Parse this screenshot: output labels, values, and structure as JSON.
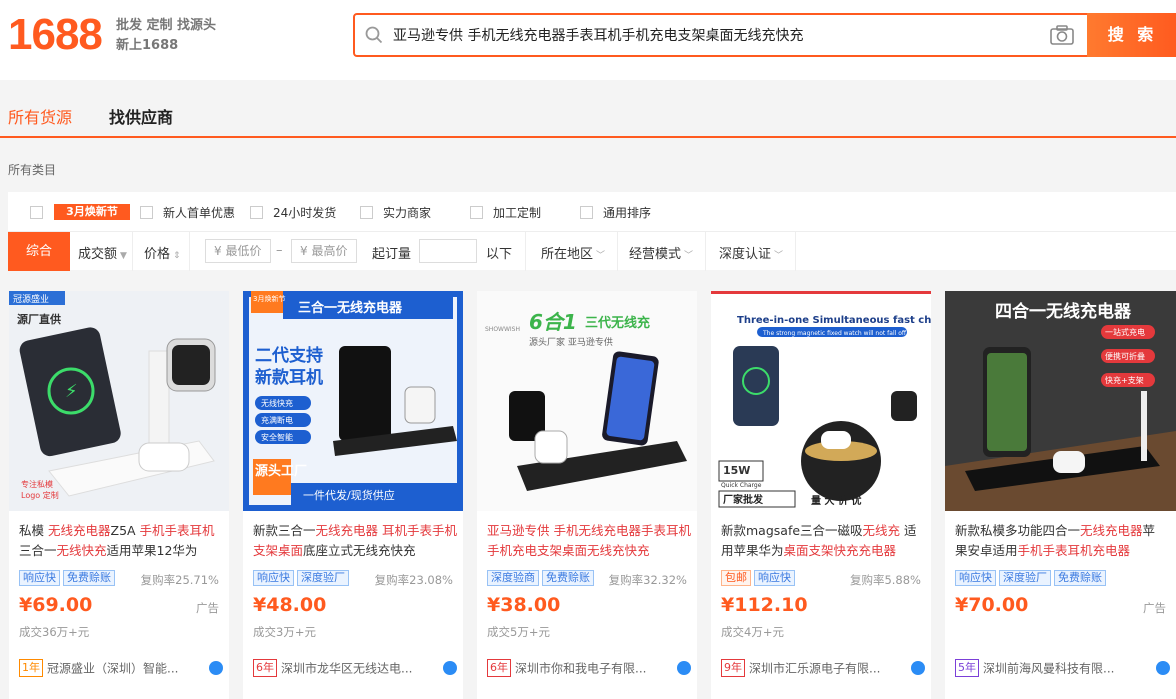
{
  "logo": {
    "text": "1688",
    "slogan_line1": "批发 定制 找源头",
    "slogan_line2": "新上1688"
  },
  "search": {
    "value": "亚马逊专供 手机无线充电器手表耳机手机充电支架桌面无线充快充",
    "button": "搜 索"
  },
  "tabs": [
    {
      "label": "所有货源",
      "active": true
    },
    {
      "label": "找供应商",
      "active": false
    }
  ],
  "category_label": "所有类目",
  "filters": {
    "promo": "3月焕新节",
    "items": [
      "新人首单优惠",
      "24小时发货",
      "实力商家",
      "加工定制",
      "通用排序"
    ]
  },
  "sortbar": {
    "active": "综合",
    "volume": "成交额",
    "price": "价格",
    "min_price": "¥ 最低价",
    "dash": "–",
    "max_price": "¥ 最高价",
    "moq": "起订量",
    "moq_suffix": "以下",
    "location": "所在地区",
    "mode": "经营模式",
    "cert": "深度认证"
  },
  "products": [
    {
      "title_parts": [
        "私模 ",
        "无线充电器",
        "Z5A ",
        "手机手表耳机",
        "三合一",
        "无线快充",
        "适用苹果12华为"
      ],
      "tags": [
        {
          "t": "响应快",
          "c": "blue"
        },
        {
          "t": "免费赊账",
          "c": "blue"
        }
      ],
      "repurchase": "复购率25.71%",
      "price": "¥69.00",
      "ad": "广告",
      "deals": "成交36万+元",
      "years": "1年",
      "shop": "冠源盛业（深圳）智能..."
    },
    {
      "title_parts": [
        "新款三合一",
        "无线充电器",
        " ",
        "耳机手表手机",
        "",
        "支架桌面",
        "底座立式无线充快充"
      ],
      "tags": [
        {
          "t": "响应快",
          "c": "blue"
        },
        {
          "t": "深度验厂",
          "c": "blue"
        }
      ],
      "repurchase": "复购率23.08%",
      "price": "¥48.00",
      "ad": "",
      "deals": "成交3万+元",
      "years": "6年",
      "shop": "深圳市龙华区无线达电..."
    },
    {
      "title_parts": [
        "",
        "亚马逊专供 手机无线充电器手表耳机手机充电支架桌面无线充快充",
        "",
        "",
        "",
        "",
        ""
      ],
      "tags": [
        {
          "t": "深度验商",
          "c": "blue"
        },
        {
          "t": "免费赊账",
          "c": "blue"
        }
      ],
      "repurchase": "复购率32.32%",
      "price": "¥38.00",
      "ad": "",
      "deals": "成交5万+元",
      "years": "6年",
      "shop": "深圳市你和我电子有限..."
    },
    {
      "title_parts": [
        "新款magsafe三合一磁吸",
        "无线充",
        " 适用苹果华为",
        "桌面支架快充充电器",
        "",
        "",
        ""
      ],
      "tags": [
        {
          "t": "包邮",
          "c": "orange"
        },
        {
          "t": "响应快",
          "c": "blue"
        }
      ],
      "repurchase": "复购率5.88%",
      "price": "¥112.10",
      "ad": "",
      "deals": "成交4万+元",
      "years": "9年",
      "shop": "深圳市汇乐源电子有限..."
    },
    {
      "title_parts": [
        "新款私模多功能四合一",
        "无线充电器",
        "苹果安卓适用",
        "手机手表耳机充电器",
        "",
        "",
        ""
      ],
      "tags": [
        {
          "t": "响应快",
          "c": "blue"
        },
        {
          "t": "深度验厂",
          "c": "blue"
        },
        {
          "t": "免费赊账",
          "c": "blue"
        }
      ],
      "repurchase": "",
      "price": "¥70.00",
      "ad": "广告",
      "deals": "",
      "years": "5年",
      "shop": "深圳前海风曼科技有限..."
    }
  ],
  "image_texts": {
    "p1": [
      "冠源盛业",
      "源厂直供",
      "专注私模",
      "Logo 定制"
    ],
    "p2": [
      "三合一无线充电器",
      "3月焕新节",
      "二代支持",
      "新款耳机",
      "无线快充",
      "充满断电",
      "安全智能",
      "源头工厂",
      "一件代发/现货供应"
    ],
    "p3": [
      "6合1",
      "三代无线充",
      "源头厂家 亚马逊专供",
      "SHOWWISH"
    ],
    "p4": [
      "Three-in-one Simultaneous fast charge",
      "The strong magnetic fixed watch will not fall off",
      "15W",
      "Quick Charge",
      "厂家批发",
      "量 大 价 优"
    ],
    "p5": [
      "四合一无线充电器",
      "一站式充电",
      "便携可折叠",
      "快充+支架"
    ]
  },
  "colors": {
    "accent": "#ff5a1f",
    "price": "#ff5a1f",
    "highlight": "#e4393c",
    "tag_blue": "#3a7ae0"
  }
}
